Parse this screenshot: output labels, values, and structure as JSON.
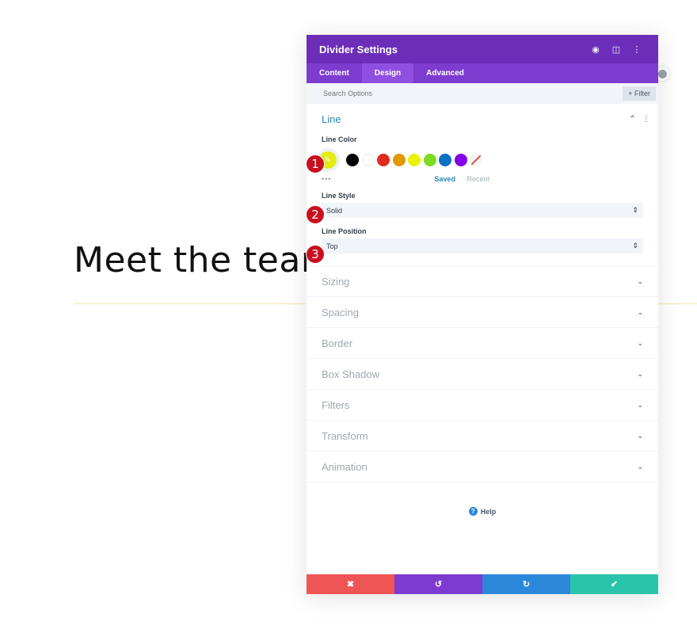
{
  "page": {
    "heading": "Meet the team",
    "divider_color": "#f5e9a8"
  },
  "modal": {
    "title": "Divider Settings",
    "header_icons": [
      "focus-icon",
      "split-view-icon",
      "more-options-icon"
    ],
    "tabs": [
      {
        "label": "Content",
        "active": false
      },
      {
        "label": "Design",
        "active": true
      },
      {
        "label": "Advanced",
        "active": false
      }
    ],
    "search": {
      "placeholder": "Search Options",
      "value": ""
    },
    "filter_label": "+ Filter",
    "line_section": {
      "title": "Line",
      "line_color": {
        "label": "Line Color",
        "current": "#e5ea10",
        "swatches": [
          "#000000",
          "#ffffff",
          "#e02b20",
          "#e09900",
          "#edf000",
          "#7cda24",
          "#0c71c3",
          "#8300e9"
        ],
        "more": "•••",
        "saved": "Saved",
        "recent": "Recent"
      },
      "line_style": {
        "label": "Line Style",
        "value": "Solid"
      },
      "line_position": {
        "label": "Line Position",
        "value": "Top"
      }
    },
    "collapsed_sections": [
      "Sizing",
      "Spacing",
      "Border",
      "Box Shadow",
      "Filters",
      "Transform",
      "Animation"
    ],
    "help_label": "Help",
    "footer": {
      "cancel_color": "#ef5555",
      "undo_color": "#7e3bd0",
      "redo_color": "#2b87da",
      "save_color": "#29c4a9"
    }
  },
  "annotations": [
    "1",
    "2",
    "3"
  ]
}
